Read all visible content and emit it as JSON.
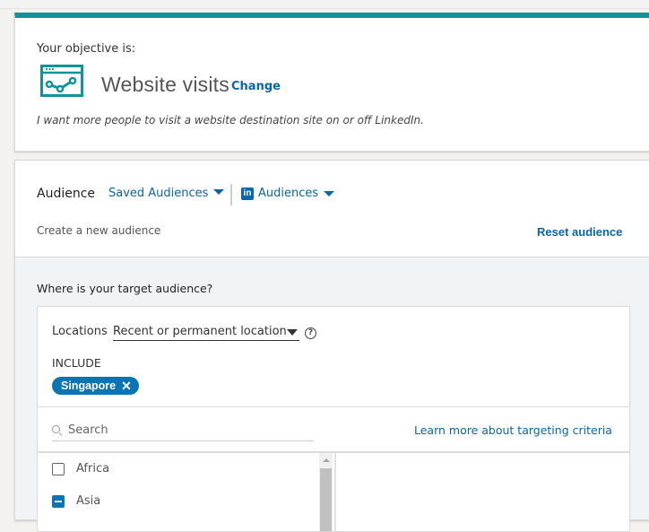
{
  "objective": {
    "label": "Your objective is:",
    "icon": "website-visits-icon",
    "title": "Website visits",
    "change_label": "Change",
    "description": "I want more people to visit a website destination site on or off LinkedIn.",
    "accent_color": "#11939a"
  },
  "audience": {
    "title": "Audience",
    "saved_audiences_label": "Saved Audiences",
    "linkedin_logo": "in",
    "audiences_label": "Audiences",
    "create_new_label": "Create a new audience",
    "reset_label": "Reset audience"
  },
  "targeting": {
    "question": "Where is your target audience?",
    "locations_label": "Locations",
    "location_type_selected": "Recent or permanent location",
    "help_glyph": "?",
    "include_label": "INCLUDE",
    "included": [
      {
        "label": "Singapore",
        "remove_glyph": "✕"
      }
    ],
    "search": {
      "placeholder": "Search",
      "value": ""
    },
    "learn_more_label": "Learn more about targeting criteria",
    "regions": [
      {
        "label": "Africa",
        "state": "unchecked"
      },
      {
        "label": "Asia",
        "state": "partial"
      }
    ]
  },
  "colors": {
    "link": "#0a66a8",
    "pill": "#0a74b5"
  }
}
